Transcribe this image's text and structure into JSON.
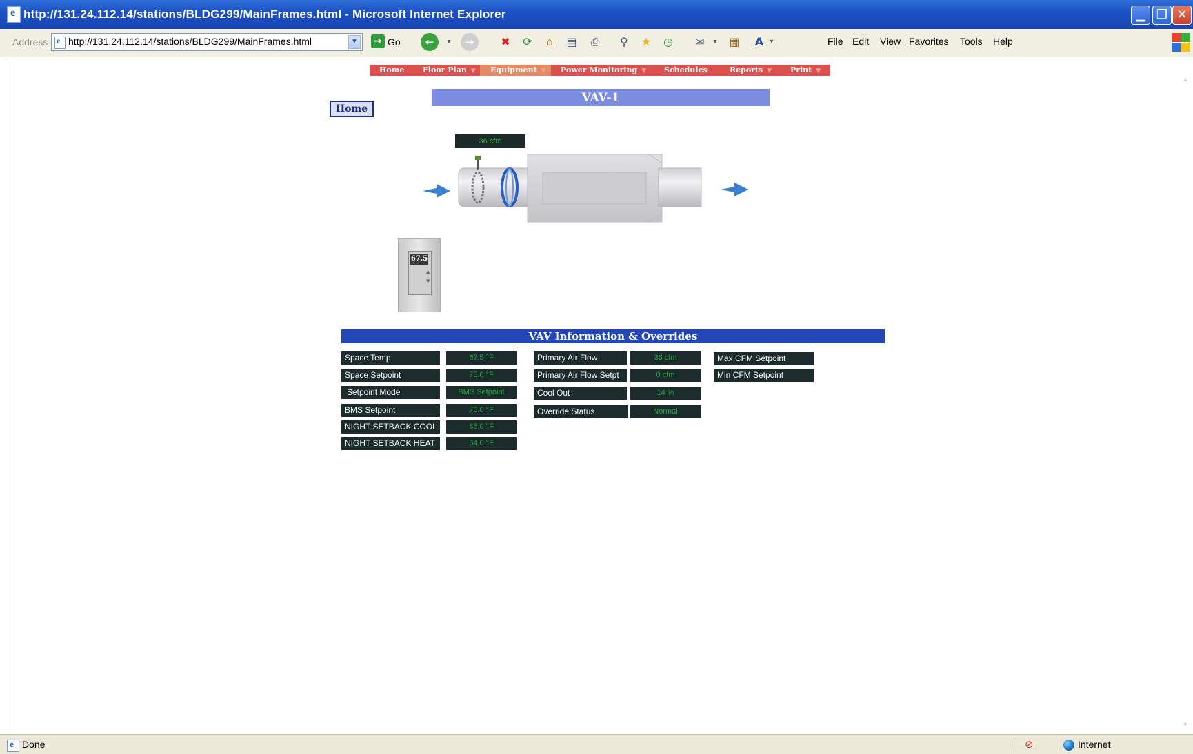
{
  "window": {
    "title": "http://131.24.112.14/stations/BLDG299/MainFrames.html - Microsoft Internet Explorer",
    "minimize": "▁",
    "maximize": "❐",
    "close": "✕"
  },
  "toolbar": {
    "address_label": "Address",
    "address_value": "http://131.24.112.14/stations/BLDG299/MainFrames.html",
    "go_label": "Go",
    "menu": [
      "File",
      "Edit",
      "View",
      "Favorites",
      "Tools",
      "Help"
    ]
  },
  "nav": {
    "items": [
      "Home",
      "Floor Plan",
      "Equipment",
      "Power Monitoring",
      "Schedules",
      "Reports",
      "Print"
    ],
    "caret": "▼"
  },
  "page": {
    "title": "VAV-1",
    "home_button": "Home",
    "flow_readout": "36 cfm",
    "thermostat_value": "67.5"
  },
  "info": {
    "header": "VAV Information & Overrides",
    "column1": [
      {
        "label": "Space Temp",
        "value": "67.5 °F"
      },
      {
        "label": "Space Setpoint",
        "value": "75.0 °F"
      },
      {
        "label": "Setpoint Mode",
        "value": "BMS Setpoint"
      },
      {
        "label": "BMS Setpoint",
        "value": "75.0 °F"
      },
      {
        "label": "NIGHT SETBACK COOL",
        "value": "85.0 °F"
      },
      {
        "label": "NIGHT SETBACK HEAT",
        "value": "64.0 °F"
      }
    ],
    "column2": [
      {
        "label": "Primary Air Flow",
        "value": "36 cfm"
      },
      {
        "label": "Primary Air Flow Setpt",
        "value": "0 cfm"
      },
      {
        "label": "Cool Out",
        "value": "14 %"
      },
      {
        "label": "Override  Status",
        "value": "Normal"
      }
    ],
    "column3": [
      {
        "label": "Max CFM Setpoint"
      },
      {
        "label": "Min CFM Setpoint"
      }
    ]
  },
  "status": {
    "text": "Done",
    "zone": "Internet"
  },
  "colors": {
    "title_bar_blue": "#1c52c7",
    "nav_red": "#d9524e",
    "nav_active": "#e58b63",
    "page_title_bg": "#7c8ce0",
    "info_header_bg": "#2447b8",
    "cell_bg": "#1c2b2c",
    "value_green": "#1fa73a"
  }
}
